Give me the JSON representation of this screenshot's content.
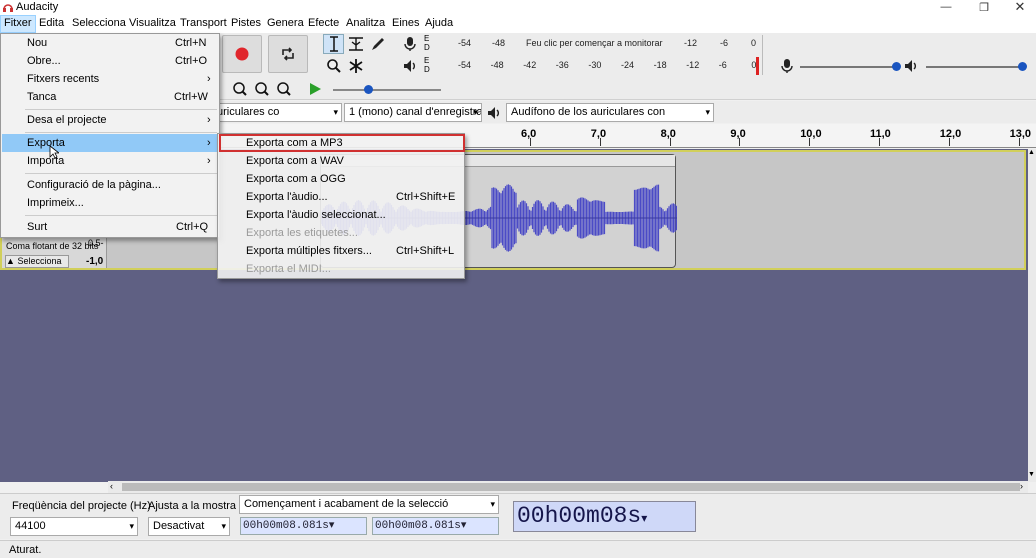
{
  "window": {
    "title": "Audacity"
  },
  "menubar": [
    "Fitxer",
    "Edita",
    "Selecciona",
    "Visualitza",
    "Transport",
    "Pistes",
    "Genera",
    "Efecte",
    "Analitza",
    "Eines",
    "Ajuda"
  ],
  "file_menu": {
    "items": [
      {
        "label": "Nou",
        "shortcut": "Ctrl+N"
      },
      {
        "label": "Obre...",
        "shortcut": "Ctrl+O"
      },
      {
        "label": "Fitxers recents",
        "submenu": true
      },
      {
        "label": "Tanca",
        "shortcut": "Ctrl+W"
      },
      {
        "label": "Desa el projecte",
        "submenu": true
      },
      {
        "label": "Exporta",
        "submenu": true
      },
      {
        "label": "Importa",
        "submenu": true
      },
      {
        "label": "Configuració de la pàgina..."
      },
      {
        "label": "Imprimeix..."
      },
      {
        "label": "Surt",
        "shortcut": "Ctrl+Q"
      }
    ]
  },
  "export_submenu": {
    "items": [
      {
        "label": "Exporta com a MP3"
      },
      {
        "label": "Exporta com a WAV"
      },
      {
        "label": "Exporta com a OGG"
      },
      {
        "label": "Exporta l'àudio...",
        "shortcut": "Ctrl+Shift+E"
      },
      {
        "label": "Exporta l'àudio seleccionat..."
      },
      {
        "label": "Exporta les etiquetes...",
        "disabled": true
      },
      {
        "label": "Exporta múltiples fitxers...",
        "shortcut": "Ctrl+Shift+L"
      },
      {
        "label": "Exporta el MIDI...",
        "disabled": true
      }
    ]
  },
  "meters": {
    "record_ticks_top": [
      "-54",
      "-48",
      "Feu clic per començar a monitorar",
      "-12",
      "-6",
      "0"
    ],
    "play_ticks": [
      "-54",
      "-48",
      "-42",
      "-36",
      "-30",
      "-24",
      "-18",
      "-12",
      "-6",
      "0"
    ],
    "lr": [
      "E",
      "D"
    ]
  },
  "mixer": {
    "rec_slider_level": 1.0,
    "play_slider_level": 1.0
  },
  "device": {
    "output": "uriculares co",
    "channels": "1 (mono) canal d'enregistra",
    "input": "Audífono de los auriculares con"
  },
  "ruler": {
    "labels": [
      "6,0",
      "7,0",
      "8,0",
      "9,0",
      "10,0",
      "11,0",
      "12,0",
      "13,0"
    ]
  },
  "track": {
    "format": "Coma flotant de 32 bits",
    "select_label": "Selecciona",
    "scale": [
      "0,5-",
      "-1,0"
    ]
  },
  "selection_bar": {
    "project_rate_label": "Freqüència del projecte (Hz)",
    "project_rate": "44100",
    "snap_label": "Ajusta a la mostra",
    "snap_value": "Desactivat",
    "selection_mode": "Començament i acabament de la selecció",
    "start_time": "00h00m08.081s",
    "end_time": "00h00m08.081s",
    "audio_position": "00h00m08s"
  },
  "status": {
    "text": "Aturat."
  },
  "colors": {
    "track_bg": "#5f6083",
    "wave": "#4b4bc6",
    "highlight": "#91c9f7",
    "export_outline": "#d03030"
  }
}
